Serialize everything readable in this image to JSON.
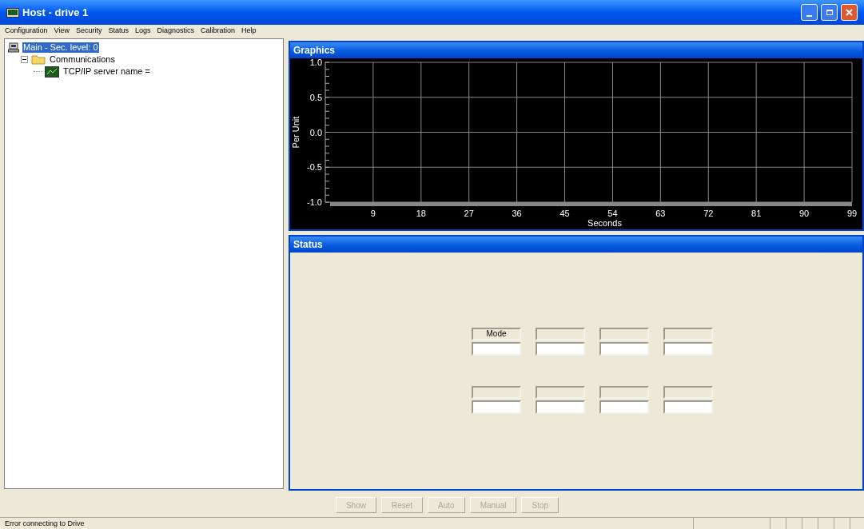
{
  "window": {
    "title": "Host - drive 1"
  },
  "menu": [
    "Configuration",
    "View",
    "Security",
    "Status",
    "Logs",
    "Diagnostics",
    "Calibration",
    "Help"
  ],
  "tree": [
    {
      "label": "Main - Sec. level: 0",
      "selected": true,
      "kind": "computer",
      "children": [
        {
          "label": "Communications",
          "selected": false,
          "kind": "folder",
          "expanded": true,
          "children": [
            {
              "label": "TCP/IP server name =",
              "selected": false,
              "kind": "monitor"
            }
          ]
        }
      ]
    }
  ],
  "graphics": {
    "title": "Graphics",
    "chart_data": {
      "type": "line",
      "grid": true,
      "xlabel": "Seconds",
      "ylabel": "Per Unit",
      "xlim": [
        0,
        99
      ],
      "ylim": [
        -1,
        1
      ],
      "xticks": [
        9,
        18,
        27,
        36,
        45,
        54,
        63,
        72,
        81,
        90,
        99
      ],
      "yticks": [
        {
          "value": 1,
          "label": "1.0"
        },
        {
          "value": 0.5,
          "label": "0.5"
        },
        {
          "value": 0,
          "label": "0.0"
        },
        {
          "value": -0.5,
          "label": "-0.5"
        },
        {
          "value": -1,
          "label": "-1.0"
        }
      ]
    }
  },
  "status_panel": {
    "title": "Status",
    "groups": [
      [
        {
          "kind": "label",
          "label": "Mode"
        },
        {
          "kind": "blank"
        },
        {
          "kind": "blank"
        },
        {
          "kind": "blank"
        }
      ],
      [
        {
          "kind": "blank"
        },
        {
          "kind": "blank"
        },
        {
          "kind": "blank"
        },
        {
          "kind": "blank"
        }
      ]
    ]
  },
  "buttons": [
    {
      "label": "Show",
      "disabled": true
    },
    {
      "label": "Reset",
      "disabled": true
    },
    {
      "label": "Auto",
      "disabled": true
    },
    {
      "label": "Manual",
      "disabled": true
    },
    {
      "label": "Stop",
      "disabled": true
    }
  ],
  "status_bar": {
    "message": "Error connecting to Drive"
  }
}
